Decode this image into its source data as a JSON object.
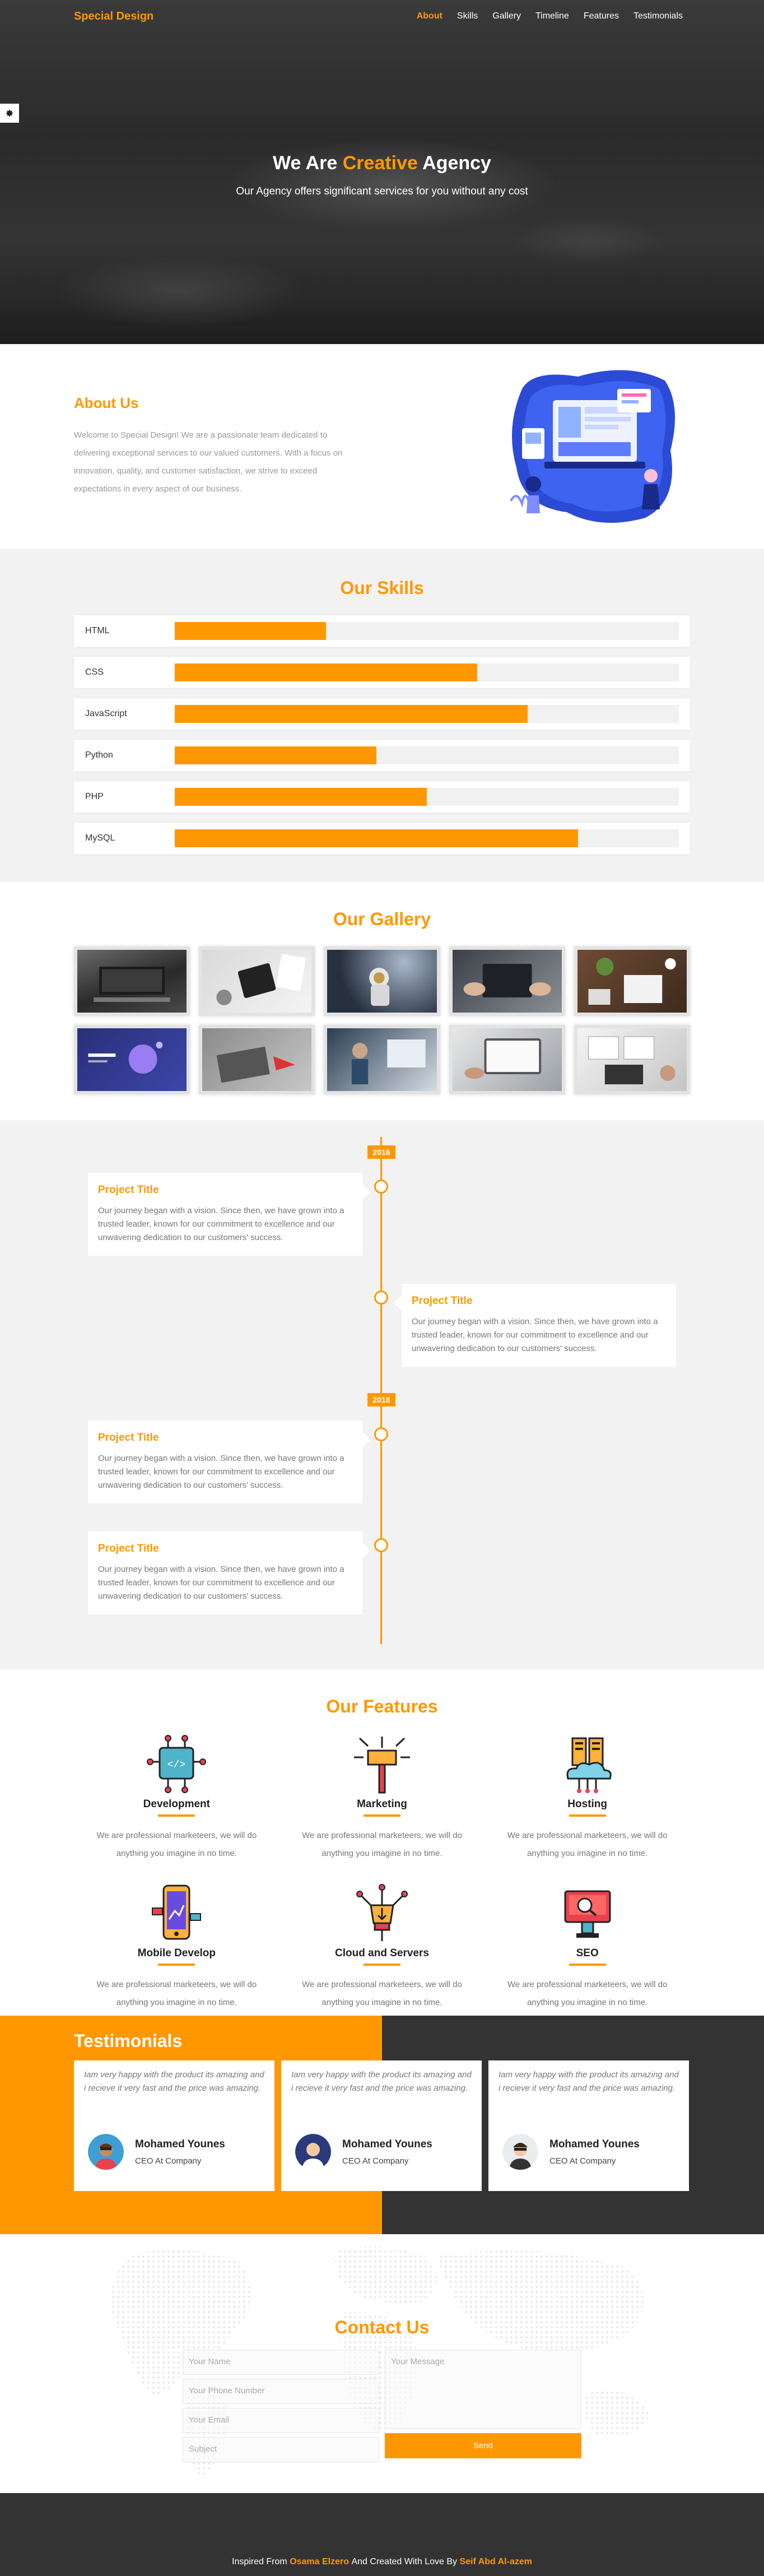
{
  "colors": {
    "accent": "#ff9800",
    "dark": "#333333",
    "light_bg": "#f2f2f2"
  },
  "header": {
    "logo": "Special Design",
    "nav": [
      {
        "label": "About",
        "active": true
      },
      {
        "label": "Skills",
        "active": false
      },
      {
        "label": "Gallery",
        "active": false
      },
      {
        "label": "Timeline",
        "active": false
      },
      {
        "label": "Features",
        "active": false
      },
      {
        "label": "Testimonials",
        "active": false
      }
    ],
    "settings_icon": "gear-icon"
  },
  "hero": {
    "title_pre": "We Are",
    "title_highlight": "Creative",
    "title_post": "Agency",
    "subtitle": "Our Agency offers significant services for you without any cost"
  },
  "about": {
    "heading": "About Us",
    "text": "Welcome to Special Design! We are a passionate team dedicated to delivering exceptional services to our valued customers. With a focus on innovation, quality, and customer satisfaction, we strive to exceed expectations in every aspect of our business."
  },
  "skills": {
    "heading": "Our Skills",
    "items": [
      {
        "name": "HTML",
        "percent": 30
      },
      {
        "name": "CSS",
        "percent": 60
      },
      {
        "name": "JavaScript",
        "percent": 70
      },
      {
        "name": "Python",
        "percent": 40
      },
      {
        "name": "PHP",
        "percent": 50
      },
      {
        "name": "MySQL",
        "percent": 80
      }
    ]
  },
  "gallery": {
    "heading": "Our Gallery"
  },
  "timeline": {
    "years": [
      "2016",
      "2018"
    ],
    "items": [
      {
        "title": "Project Title",
        "text": "Our journey began with a vision. Since then, we have grown into a trusted leader, known for our commitment to excellence and our unwavering dedication to our customers' success."
      },
      {
        "title": "Project Title",
        "text": "Our journey began with a vision. Since then, we have grown into a trusted leader, known for our commitment to excellence and our unwavering dedication to our customers' success."
      },
      {
        "title": "Project Title",
        "text": "Our journey began with a vision. Since then, we have grown into a trusted leader, known for our commitment to excellence and our unwavering dedication to our customers' success."
      },
      {
        "title": "Project Title",
        "text": "Our journey began with a vision. Since then, we have grown into a trusted leader, known for our commitment to excellence and our unwavering dedication to our customers' success."
      }
    ]
  },
  "features": {
    "heading": "Our Features",
    "items": [
      {
        "title": "Development",
        "icon": "development-icon",
        "text": "We are professional marketeers, we will do anything you imagine in no time."
      },
      {
        "title": "Marketing",
        "icon": "marketing-icon",
        "text": "We are professional marketeers, we will do anything you imagine in no time."
      },
      {
        "title": "Hosting",
        "icon": "hosting-icon",
        "text": "We are professional marketeers, we will do anything you imagine in no time."
      },
      {
        "title": "Mobile Develop",
        "icon": "mobile-icon",
        "text": "We are professional marketeers, we will do anything you imagine in no time."
      },
      {
        "title": "Cloud and Servers",
        "icon": "cloud-icon",
        "text": "We are professional marketeers, we will do anything you imagine in no time."
      },
      {
        "title": "SEO",
        "icon": "seo-icon",
        "text": "We are professional marketeers, we will do anything you imagine in no time."
      }
    ]
  },
  "testimonials": {
    "heading": "Testimonials",
    "items": [
      {
        "quote": "Iam very happy with the product its amazing and i recieve it very fast and the price was amazing.",
        "name": "Mohamed Younes",
        "title": "CEO At Company"
      },
      {
        "quote": "Iam very happy with the product its amazing and i recieve it very fast and the price was amazing.",
        "name": "Mohamed Younes",
        "title": "CEO At Company"
      },
      {
        "quote": "Iam very happy with the product its amazing and i recieve it very fast and the price was amazing.",
        "name": "Mohamed Younes",
        "title": "CEO At Company"
      }
    ]
  },
  "contact": {
    "heading": "Contact Us",
    "name_placeholder": "Your Name",
    "phone_placeholder": "Your Phone Number",
    "email_placeholder": "Your Email",
    "subject_placeholder": "Subject",
    "message_placeholder": "Your Message",
    "send_label": "Send"
  },
  "footer": {
    "pre": "Inspired From",
    "author1": "Osama Elzero",
    "mid": "And Created With Love By",
    "author2": "Seif Abd Al-azem"
  }
}
